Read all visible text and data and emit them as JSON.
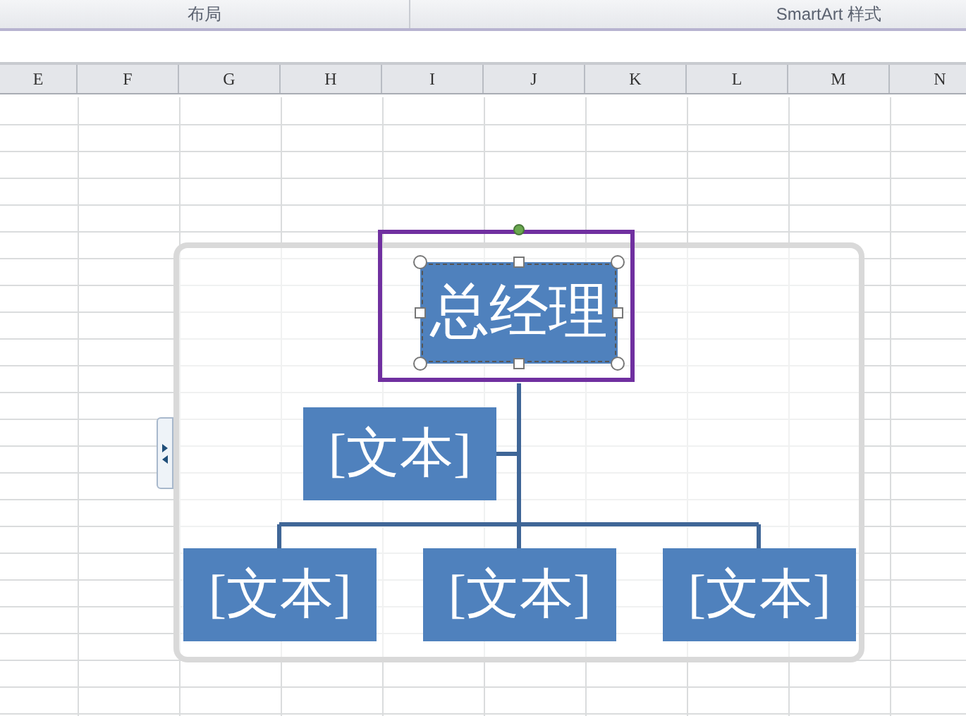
{
  "ribbon_groups": [
    "布局",
    "SmartArt 样式"
  ],
  "columns": [
    "E",
    "F",
    "G",
    "H",
    "I",
    "J",
    "K",
    "L",
    "M",
    "N"
  ],
  "smartart": {
    "top": {
      "text": "总经理",
      "selected": true,
      "highlighted": true
    },
    "assistant": {
      "text": "[文本]",
      "selected": false
    },
    "children": [
      {
        "text": "[文本]",
        "selected": false
      },
      {
        "text": "[文本]",
        "selected": false
      },
      {
        "text": "[文本]",
        "selected": false
      }
    ]
  }
}
